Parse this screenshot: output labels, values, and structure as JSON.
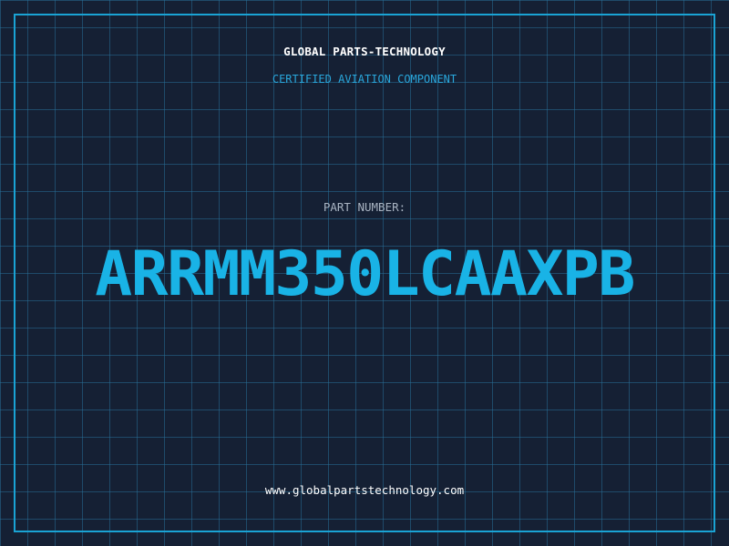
{
  "header": {
    "company": "GLOBAL PARTS-TECHNOLOGY",
    "subtitle": "CERTIFIED AVIATION COMPONENT"
  },
  "part": {
    "label": "PART NUMBER:",
    "number": "ARRMM350LCAAXPB"
  },
  "footer": {
    "website": "www.globalpartstechnology.com"
  },
  "colors": {
    "background": "#152034",
    "grid": "#286e96",
    "accent": "#19b3e6",
    "frame": "#1aa3d4"
  }
}
